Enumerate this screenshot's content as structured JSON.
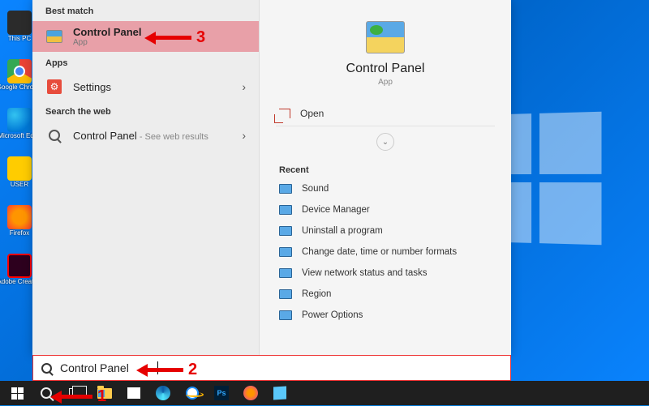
{
  "desktop": {
    "icons": [
      {
        "label": "This PC"
      },
      {
        "label": "Google Chrome"
      },
      {
        "label": "Microsoft Edge"
      },
      {
        "label": "USER"
      },
      {
        "label": "Firefox"
      },
      {
        "label": "Adobe Creative"
      }
    ]
  },
  "search": {
    "headers": {
      "best_match": "Best match",
      "apps": "Apps",
      "web": "Search the web"
    },
    "best_match": {
      "title": "Control Panel",
      "subtitle": "App"
    },
    "apps": {
      "settings_label": "Settings"
    },
    "web": {
      "title": "Control Panel",
      "suffix": " - See web results"
    },
    "input_value": "Control Panel"
  },
  "preview": {
    "title": "Control Panel",
    "subtitle": "App",
    "open_label": "Open",
    "recent_header": "Recent",
    "recent": [
      "Sound",
      "Device Manager",
      "Uninstall a program",
      "Change date, time or number formats",
      "View network status and tasks",
      "Region",
      "Power Options"
    ]
  },
  "annotations": {
    "n1": "1",
    "n2": "2",
    "n3": "3"
  }
}
